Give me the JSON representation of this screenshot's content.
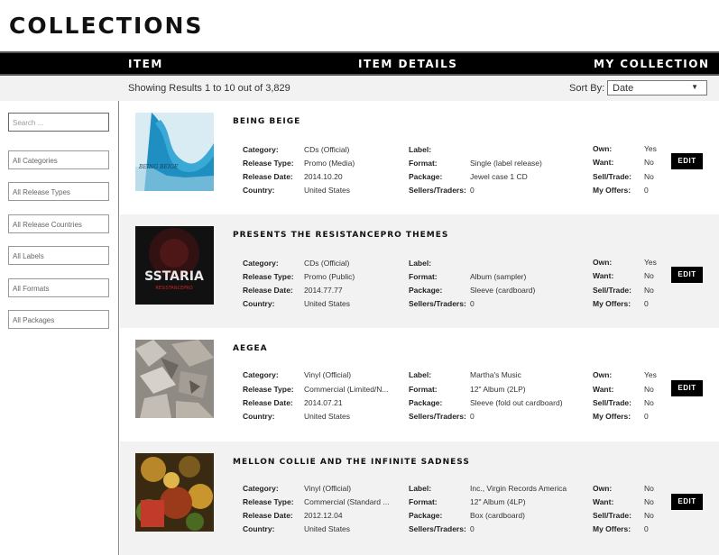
{
  "page": {
    "title": "COLLECTIONS"
  },
  "header": {
    "item": "ITEM",
    "item_details": "ITEM DETAILS",
    "my_collection": "MY COLLECTION"
  },
  "results": {
    "text": "Showing Results 1 to 10 out of 3,829",
    "sort_label": "Sort By:",
    "sort_value": "Date"
  },
  "filters": {
    "search_placeholder": "Search ...",
    "categories": "All Categories",
    "release_types": "All Release Types",
    "release_countries": "All Release Countries",
    "labels": "All Labels",
    "formats": "All Formats",
    "packages": "All Packages"
  },
  "labels": {
    "category": "Category:",
    "release_type": "Release Type:",
    "release_date": "Release Date:",
    "country": "Country:",
    "label": "Label:",
    "format": "Format:",
    "package": "Package:",
    "sellers": "Sellers/Traders:",
    "own": "Own:",
    "want": "Want:",
    "sell_trade": "Sell/Trade:",
    "my_offers": "My Offers:",
    "edit": "EDIT"
  },
  "items": [
    {
      "title": "BEING BEIGE",
      "category": "CDs (Official)",
      "release_type": "Promo (Media)",
      "release_date": "2014.10.20",
      "country": "United States",
      "label": "",
      "format": "Single (label release)",
      "package": "Jewel case 1 CD",
      "sellers": "0",
      "own": "Yes",
      "want": "No",
      "sell_trade": "No",
      "my_offers": "0",
      "cover_text": "BEING BEIGE"
    },
    {
      "title": "PRESENTS THE RESISTANCEPRO THEMES",
      "category": "CDs (Official)",
      "release_type": "Promo (Public)",
      "release_date": "2014.77.77",
      "country": "United States",
      "label": "",
      "format": "Album (sampler)",
      "package": "Sleeve (cardboard)",
      "sellers": "0",
      "own": "Yes",
      "want": "No",
      "sell_trade": "No",
      "my_offers": "0",
      "cover_text": "SSTARIA",
      "cover_subtext": "RESISTANCEPRO"
    },
    {
      "title": "AEGEA",
      "category": "Vinyl (Official)",
      "release_type": "Commercial (Limited/N...",
      "release_date": "2014.07.21",
      "country": "United States",
      "label": "Martha's Music",
      "format": "12\" Album (2LP)",
      "package": "Sleeve (fold out cardboard)",
      "sellers": "0",
      "own": "Yes",
      "want": "No",
      "sell_trade": "No",
      "my_offers": "0"
    },
    {
      "title": "MELLON COLLIE AND THE INFINITE SADNESS",
      "category": "Vinyl (Official)",
      "release_type": "Commercial (Standard ...",
      "release_date": "2012.12.04",
      "country": "United States",
      "label": "Inc., Virgin Records America",
      "format": "12\" Album (4LP)",
      "package": "Box (cardboard)",
      "sellers": "0",
      "own": "No",
      "want": "No",
      "sell_trade": "No",
      "my_offers": "0"
    }
  ]
}
